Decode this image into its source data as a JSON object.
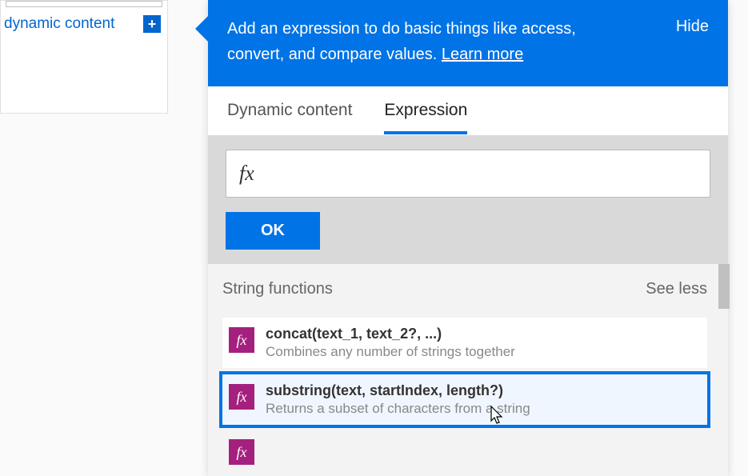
{
  "left": {
    "dynamic_content_label": "dynamic content"
  },
  "flyout": {
    "header_text_1": "Add an expression to do basic things like access, convert, and compare values. ",
    "learn_more": "Learn more",
    "hide": "Hide",
    "tabs": {
      "dynamic_content": "Dynamic content",
      "expression": "Expression"
    },
    "fx_symbol": "fx",
    "ok_label": "OK",
    "functions": {
      "title": "String functions",
      "see_less": "See less",
      "items": [
        {
          "signature": "concat(text_1, text_2?, ...)",
          "description": "Combines any number of strings together",
          "selected": false
        },
        {
          "signature": "substring(text, startIndex, length?)",
          "description": "Returns a subset of characters from a string",
          "selected": true
        }
      ]
    },
    "fx_badge": "fx"
  }
}
